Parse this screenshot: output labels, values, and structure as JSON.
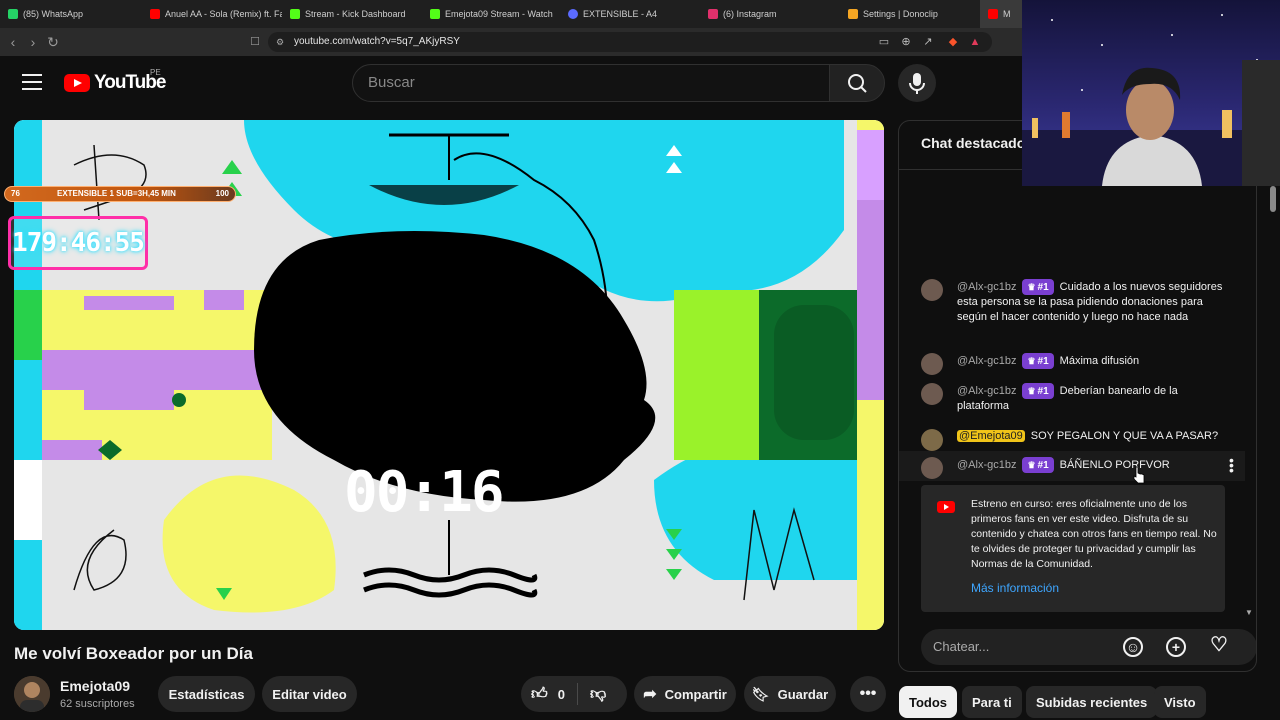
{
  "browser": {
    "tabs": [
      {
        "label": "(85) WhatsApp",
        "color": "#25d366"
      },
      {
        "label": "Anuel AA - Sola (Remix) ft. Far",
        "color": "#ff0000"
      },
      {
        "label": "Stream - Kick Dashboard",
        "color": "#53fc18"
      },
      {
        "label": "Emejota09 Stream - Watch",
        "color": "#53fc18"
      },
      {
        "label": "EXTENSIBLE - A4",
        "color": "#5b6bff"
      },
      {
        "label": "(6) Instagram",
        "color": "#e1306c"
      },
      {
        "label": "Settings | Donoclip",
        "color": "#f5a623"
      },
      {
        "label": "M",
        "color": "#ff0000"
      }
    ],
    "url": "youtube.com/watch?v=5q7_AKjyRSY"
  },
  "header": {
    "logo_text": "YouTube",
    "region_code": "PE",
    "search_placeholder": "Buscar"
  },
  "player": {
    "countdown": "00:16",
    "sub_bar": {
      "left": "76",
      "label": "EXTENSIBLE 1 SUB=3H,45 MIN",
      "right": "100"
    },
    "stream_timer": "179:46:55"
  },
  "video": {
    "title": "Me volví Boxeador por un Día",
    "channel_name": "Emejota09",
    "subscribers": "62 suscriptores",
    "stats_button": "Estadísticas",
    "edit_button": "Editar video",
    "like_count": "0",
    "share_button": "Compartir",
    "save_button": "Guardar"
  },
  "chat": {
    "title": "Chat destacado",
    "messages": [
      {
        "author": "@Alx-gc1bz",
        "rank": "#1",
        "text": "Cuidado a los nuevos seguidores esta persona se la pasa pidiendo donaciones para según el hacer contenido y luego no hace nada"
      },
      {
        "author": "@Alx-gc1bz",
        "rank": "#1",
        "text": "Máxima difusión"
      },
      {
        "author": "@Alx-gc1bz",
        "rank": "#1",
        "text": "Deberían banearlo de la plataforma"
      },
      {
        "author": "@Emejota09",
        "rank": "",
        "text": "SOY PEGALON Y QUE VA A PASAR?"
      },
      {
        "author": "@Alx-gc1bz",
        "rank": "#1",
        "text": "BÁÑENLO PORFVOR"
      }
    ],
    "info_card": {
      "text": "Estreno en curso: eres oficialmente uno de los primeros fans en ver este video. Disfruta de su contenido y chatea con otros fans en tiempo real. No te olvides de proteger tu privacidad y cumplir las Normas de la Comunidad.",
      "link": "Más información"
    },
    "input_placeholder": "Chatear..."
  },
  "chips": [
    "Todos",
    "Para ti",
    "Subidas recientes",
    "Visto"
  ],
  "colors": {
    "background": "#0f0f0f",
    "accent_red": "#ff0000",
    "rank_purple": "#7a3fd1",
    "link_blue": "#3ea6ff",
    "player_cyan": "#1fd6ee",
    "player_yellow": "#f5f76a"
  }
}
